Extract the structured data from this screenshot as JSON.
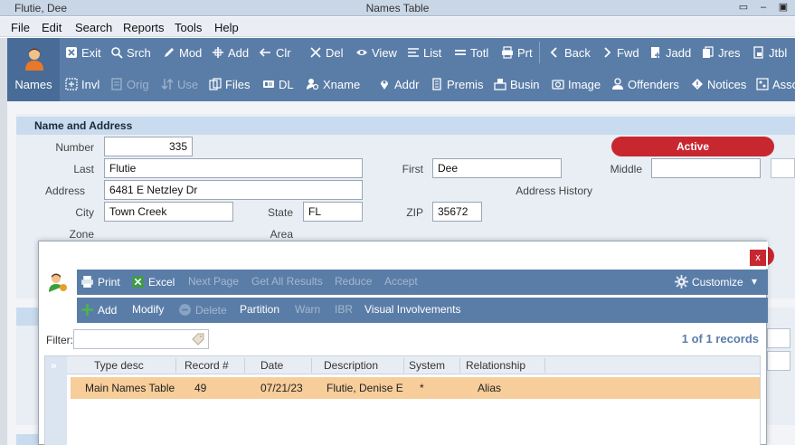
{
  "window": {
    "title_left": "Flutie, Dee",
    "title_center": "Names Table",
    "ctrls": [
      "▭",
      "–",
      "▣"
    ]
  },
  "menu": [
    "File",
    "Edit",
    "Search",
    "Reports",
    "Tools",
    "Help"
  ],
  "toolbar": {
    "tile_label": "Names",
    "row1": [
      "Exit",
      "Srch",
      "Mod",
      "Add",
      "Clr",
      "Del",
      "View",
      "List",
      "Totl",
      "Prt",
      "Back",
      "Fwd",
      "Jadd",
      "Jres",
      "Jtbl"
    ],
    "row2": [
      "Invl",
      "Orig",
      "Use",
      "Files",
      "DL",
      "Xname",
      "Addr",
      "Premis",
      "Busin",
      "Image",
      "Offenders",
      "Notices",
      "Asso"
    ]
  },
  "section": {
    "title": "Name and Address"
  },
  "labels": {
    "number": "Number",
    "last": "Last",
    "first": "First",
    "middle": "Middle",
    "address": "Address",
    "address_history": "Address History",
    "city": "City",
    "state": "State",
    "zip": "ZIP",
    "zone": "Zone",
    "area": "Area"
  },
  "fields": {
    "number": "335",
    "last": "Flutie",
    "first": "Dee",
    "middle": "",
    "address": "6481 E Netzley Dr",
    "city": "Town Creek",
    "state": "FL",
    "zip": "35672"
  },
  "status": "Active",
  "modal": {
    "close": "x",
    "toolbar1": [
      "Print",
      "Excel",
      "Next Page",
      "Get All Results",
      "Reduce",
      "Accept"
    ],
    "customize": "Customize",
    "toolbar2": [
      "Add",
      "Modify",
      "Delete",
      "Partition",
      "Warn",
      "IBR",
      "Visual Involvements"
    ],
    "filter_label": "Filter:",
    "filter_value": "",
    "records": "1 of 1 records",
    "columns": [
      "Type desc",
      "Record #",
      "Date",
      "Description",
      "System",
      "Relationship"
    ],
    "rows": [
      [
        "Main Names Table",
        "49",
        "07/21/23",
        "Flutie, Denise E",
        "*",
        "Alias"
      ]
    ]
  },
  "colors": {
    "toolbar": "#5a7da8",
    "active": "#c8272f",
    "selected_row": "#f7cd9a"
  }
}
